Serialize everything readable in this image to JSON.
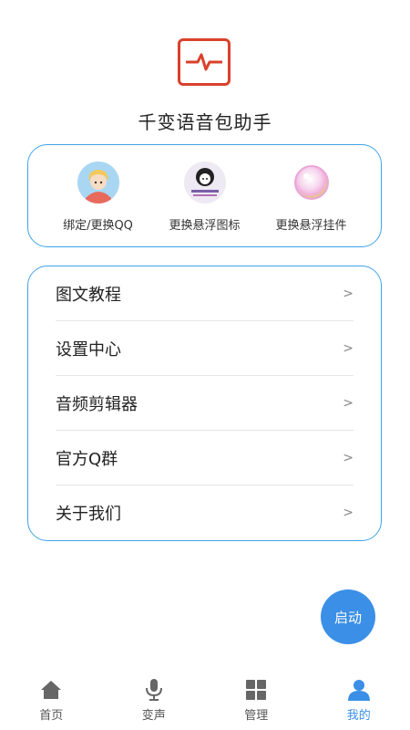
{
  "app": {
    "title": "千变语音包助手",
    "logo_icon": "pulse-icon"
  },
  "quick_actions": [
    {
      "label": "绑定/更换QQ",
      "icon": "qq-avatar-icon"
    },
    {
      "label": "更换悬浮图标",
      "icon": "float-icon-avatar"
    },
    {
      "label": "更换悬浮挂件",
      "icon": "bubble-widget-icon"
    }
  ],
  "menu": [
    {
      "label": "图文教程",
      "chevron": ">"
    },
    {
      "label": "设置中心",
      "chevron": ">"
    },
    {
      "label": "音频剪辑器",
      "chevron": ">"
    },
    {
      "label": "官方Q群",
      "chevron": ">"
    },
    {
      "label": "关于我们",
      "chevron": ">"
    }
  ],
  "fab": {
    "label": "启动"
  },
  "tabs": [
    {
      "label": "首页",
      "icon": "home-icon",
      "active": false
    },
    {
      "label": "变声",
      "icon": "microphone-icon",
      "active": false
    },
    {
      "label": "管理",
      "icon": "grid-icon",
      "active": false
    },
    {
      "label": "我的",
      "icon": "user-icon",
      "active": true
    }
  ],
  "colors": {
    "accent": "#3b8fe6",
    "card_border": "#3fa3e8",
    "logo": "#d9412b"
  }
}
